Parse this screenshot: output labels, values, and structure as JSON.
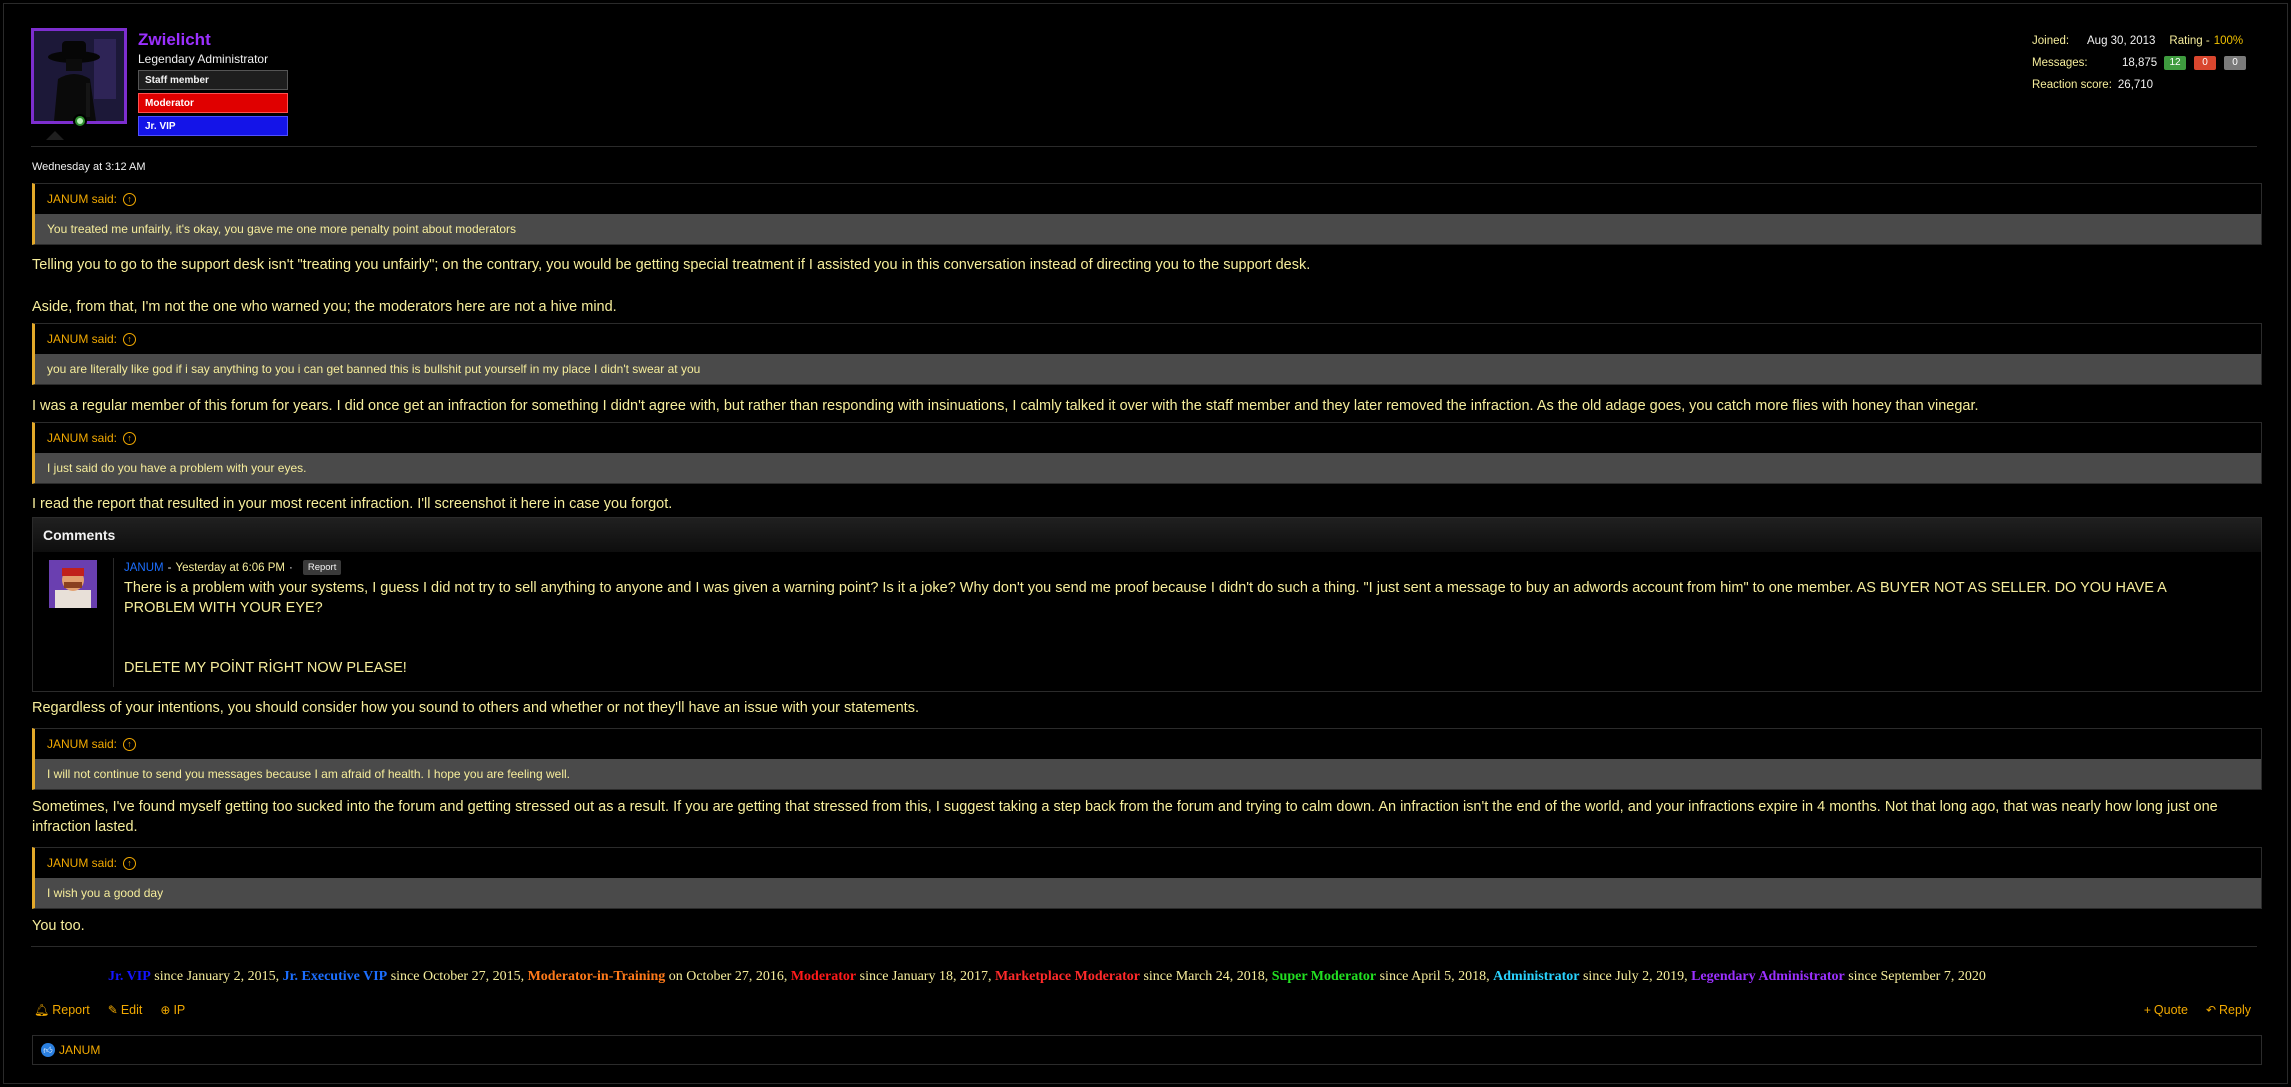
{
  "author": {
    "username": "Zwielicht",
    "title": "Legendary Administrator",
    "banners": [
      "Staff member",
      "Moderator",
      "Jr. VIP"
    ]
  },
  "stats": {
    "joined_label": "Joined:",
    "joined_value": "Aug 30, 2013",
    "rating_label": "Rating -",
    "rating_value": "100%",
    "messages_label": "Messages:",
    "messages_value": "18,875",
    "pill_positive": "12",
    "pill_negative": "0",
    "pill_neutral": "0",
    "reaction_label": "Reaction score:",
    "reaction_value": "26,710"
  },
  "post": {
    "date": "Wednesday at 3:12 AM",
    "quote_author": "JANUM said:",
    "quotes": [
      "You treated me unfairly, it's okay, you gave me one more penalty point about moderators",
      "you are literally like god if i say anything to you i can get banned this is bullshit put yourself in my place I didn't swear at you",
      "I just said do you have a problem with your eyes.",
      "I will not continue to send you messages because I am afraid of health. I hope you are feeling well.",
      "I wish you a good day"
    ],
    "paragraphs": [
      "Telling you to go to the support desk isn't \"treating you unfairly\"; on the contrary, you would be getting special treatment if I assisted you in this conversation instead of directing you to the support desk.",
      "Aside, from that, I'm not the one who warned you; the moderators here are not a hive mind.",
      "I was a regular member of this forum for years. I did once get an infraction for something I didn't agree with, but rather than responding with insinuations, I calmly talked it over with the staff member and they later removed the infraction. As the old adage goes, you catch more flies with honey than vinegar.",
      "I read the report that resulted in your most recent infraction. I'll screenshot it here in case you forgot.",
      "Regardless of your intentions, you should consider how you sound to others and whether or not they'll have an issue with your statements.",
      "Sometimes, I've found myself getting too sucked into the forum and getting stressed out as a result. If you are getting that stressed from this, I suggest taking a step back from the forum and trying to calm down. An infraction isn't the end of the world, and your infractions expire in 4 months. Not that long ago, that was nearly how long just one infraction lasted.",
      "You too."
    ]
  },
  "comments": {
    "heading": "Comments",
    "user": "JANUM",
    "dash": "-",
    "time": "Yesterday at 6:06 PM",
    "time_sep": "·",
    "report": "Report",
    "text": "There is a problem with your systems, I guess I did not try to sell anything to anyone and I was given a warning point? Is it a joke? Why don't you send me proof because I didn't do such a thing. \"I just sent a message to buy an adwords account from him\" to one member. AS BUYER NOT AS SELLER. DO YOU HAVE A PROBLEM WITH YOUR EYE?",
    "text2": "DELETE MY POİNT RİGHT NOW PLEASE!"
  },
  "history": [
    {
      "group": "Jr. VIP",
      "color": "#1414ff",
      "rest": " since January 2, 2015, "
    },
    {
      "group": "Jr. Executive VIP",
      "color": "#1c6fff",
      "rest": " since October 27, 2015, "
    },
    {
      "group": "Moderator-in-Training",
      "color": "#ff7a1a",
      "rest": " on October 27, 2016, "
    },
    {
      "group": "Moderator",
      "color": "#ff1a1a",
      "rest": " since January 18, 2017, "
    },
    {
      "group": "Marketplace Moderator",
      "color": "#ff2a2a",
      "rest": " since March 24, 2018, "
    },
    {
      "group": "Super Moderator",
      "color": "#22e022",
      "rest": " since April 5, 2018, "
    },
    {
      "group": "Administrator",
      "color": "#2ad4ff",
      "rest": " since July 2, 2019, "
    },
    {
      "group": "Legendary Administrator",
      "color": "#9b30ff",
      "rest": " since September 7, 2020"
    }
  ],
  "actions": {
    "report": "Report",
    "edit": "Edit",
    "ip": "IP",
    "quote": "Quote",
    "reply": "Reply"
  },
  "reactions": {
    "user": "JANUM"
  },
  "colors": {
    "background": "#000000",
    "text": "#f6ed9b",
    "accent": "#f2a900",
    "username": "#9b30ff",
    "quote_bar": "#e3a92a",
    "quote_body": "#4a4a4a"
  }
}
